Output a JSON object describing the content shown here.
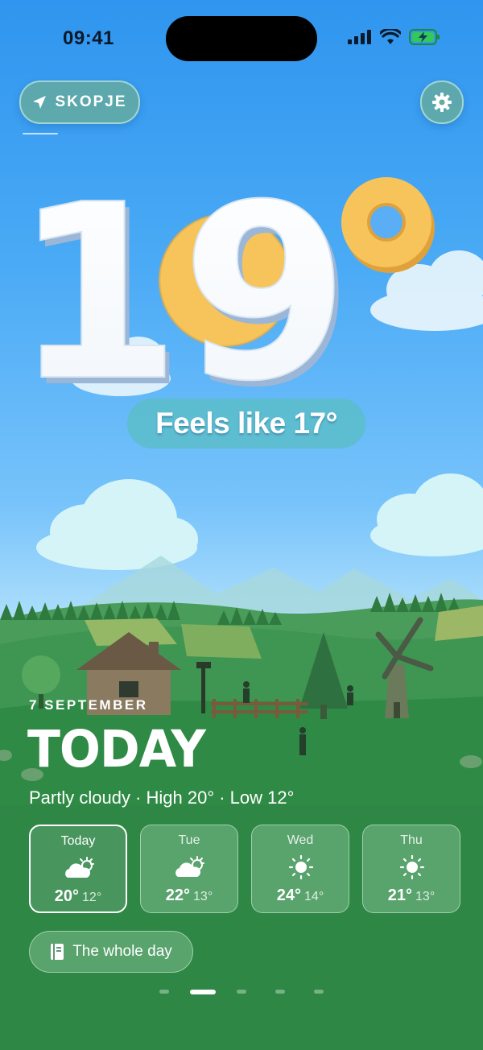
{
  "status_bar": {
    "time": "09:41",
    "icons": [
      "cellular-signal-icon",
      "wifi-icon",
      "battery-charging-icon"
    ]
  },
  "header": {
    "location": "SKOPJE",
    "location_icon": "location-arrow-icon",
    "settings_icon": "gear-icon"
  },
  "current": {
    "temperature": "19",
    "degree_symbol": "°",
    "feels_like": "Feels like 17°"
  },
  "today": {
    "date": "7 SEPTEMBER",
    "title": "TODAY",
    "summary": "Partly cloudy · High 20° · Low 12°"
  },
  "forecast": [
    {
      "day": "Today",
      "icon": "partly-cloudy-icon",
      "high": "20°",
      "low": "12°",
      "selected": true
    },
    {
      "day": "Tue",
      "icon": "partly-cloudy-icon",
      "high": "22°",
      "low": "13°",
      "selected": false
    },
    {
      "day": "Wed",
      "icon": "sun-icon",
      "high": "24°",
      "low": "14°",
      "selected": false
    },
    {
      "day": "Thu",
      "icon": "sun-icon",
      "high": "21°",
      "low": "13°",
      "selected": false
    }
  ],
  "whole_day_button": {
    "label": "The whole day",
    "icon": "book-icon"
  },
  "pagination": {
    "pages": 5,
    "current_index": 1
  },
  "colors": {
    "sky_top": "#2f95ee",
    "grass": "#2f8a45",
    "sun_yellow": "#f6c45a",
    "pill_teal": "#64aaa0"
  }
}
